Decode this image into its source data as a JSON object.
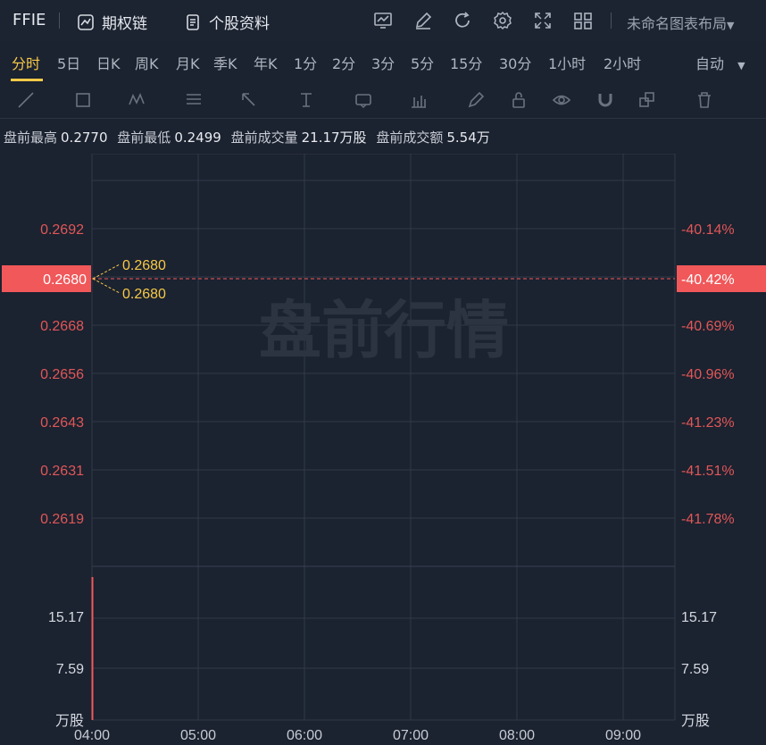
{
  "header": {
    "ticker": "FFIE",
    "options_chain": "期权链",
    "profile": "个股资料",
    "layout": "未命名图表布局"
  },
  "toolbar_icons": [
    "chart-settings-icon",
    "edit-icon",
    "refresh-icon",
    "gear-icon",
    "fullscreen-icon",
    "grid-layout-icon"
  ],
  "periods": [
    "分时",
    "5日",
    "日K",
    "周K",
    "月K",
    "季K",
    "年K",
    "1分",
    "2分",
    "3分",
    "5分",
    "15分",
    "30分",
    "1小时",
    "2小时"
  ],
  "active_period": "分时",
  "auto_label": "自动",
  "draw_tools": [
    "line-tool-icon",
    "rect-tool-icon",
    "wave-tool-icon",
    "fib-tool-icon",
    "arrow-tool-icon",
    "text-cursor-icon",
    "label-tool-icon",
    "measure-tool-icon",
    "pen-icon",
    "lock-icon",
    "eye-icon",
    "magnet-icon",
    "layers-icon",
    "trash-icon"
  ],
  "info": {
    "pre_high_label": "盘前最高",
    "pre_high": "0.2770",
    "pre_low_label": "盘前最低",
    "pre_low": "0.2499",
    "pre_vol_label": "盘前成交量",
    "pre_vol": "21.17万股",
    "pre_amt_label": "盘前成交额",
    "pre_amt": "5.54万"
  },
  "watermark": "盘前行情",
  "colors": {
    "price": "#e05757",
    "current_bg": "#f0585a",
    "annotation": "#f7c948",
    "volume_bar": "#f0585a"
  },
  "chart_data": {
    "type": "line",
    "price_ticks": [
      "0.2692",
      "0.2680",
      "0.2668",
      "0.2656",
      "0.2643",
      "0.2631",
      "0.2619"
    ],
    "pct_ticks": [
      "-40.14%",
      "-40.42%",
      "-40.69%",
      "-40.96%",
      "-41.23%",
      "-41.51%",
      "-41.78%"
    ],
    "current_price": "0.2680",
    "current_pct": "-40.42%",
    "annotations": [
      "0.2680",
      "0.2680"
    ],
    "volume_ticks": [
      "15.17",
      "7.59",
      "万股"
    ],
    "volume_unit": "万股",
    "x_labels": [
      "04:00",
      "05:00",
      "06:00",
      "07:00",
      "08:00",
      "09:00"
    ],
    "volume_bars": [
      {
        "x": "04:00",
        "value": 21.17
      }
    ],
    "volume_max": 22.75
  }
}
